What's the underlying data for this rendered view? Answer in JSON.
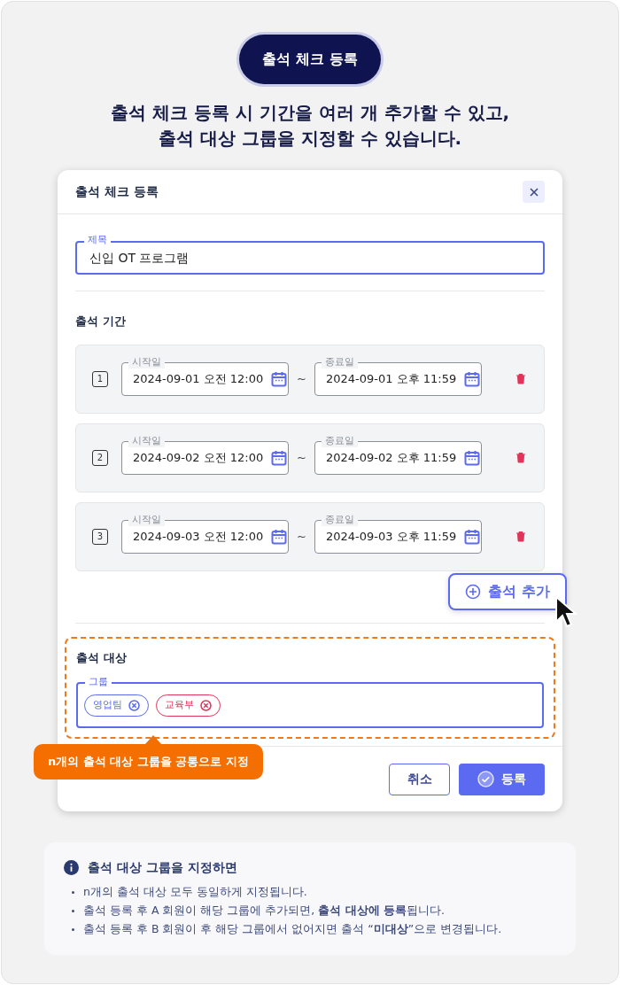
{
  "badge": "출석 체크 등록",
  "headline": [
    "출석 체크 등록 시 기간을 여러 개 추가할 수 있고,",
    "출석 대상 그룹을 지정할 수 있습니다."
  ],
  "dialog": {
    "title": "출석 체크 등록",
    "title_field": {
      "label": "제목",
      "value": "신입 OT 프로그램"
    },
    "period_section": "출석 기간",
    "periods": [
      {
        "number": "1",
        "start_label": "시작일",
        "start": "2024-09-01 오전 12:00",
        "separator": "~",
        "end_label": "종료일",
        "end": "2024-09-01 오후 11:59"
      },
      {
        "number": "2",
        "start_label": "시작일",
        "start": "2024-09-02 오전 12:00",
        "separator": "~",
        "end_label": "종료일",
        "end": "2024-09-02 오후 11:59"
      },
      {
        "number": "3",
        "start_label": "시작일",
        "start": "2024-09-03 오전 12:00",
        "separator": "~",
        "end_label": "종료일",
        "end": "2024-09-03 오후 11:59"
      }
    ],
    "add_button": "출석 추가",
    "target_section": "출석 대상",
    "group_field": {
      "label": "그룹",
      "chips": [
        {
          "label": "영업팀",
          "color": "#5b6af0"
        },
        {
          "label": "교육부",
          "color": "#e0345a"
        }
      ]
    },
    "callout": "n개의 출석 대상 그룹을 공통으로 지정",
    "cancel_button": "취소",
    "submit_button": "등록"
  },
  "info": {
    "title": "출석 대상 그룹을 지정하면",
    "items": [
      "n개의 출석 대상 모두 동일하게 지정됩니다.",
      "출석 등록 후 A 회원이 해당 그룹에 추가되면, **출석 대상에 등록**됩니다.",
      "출석 등록 후 B 회원이 후 해당 그룹에서 없어지면 출석 “**미대상**”으로 변경됩니다."
    ]
  }
}
